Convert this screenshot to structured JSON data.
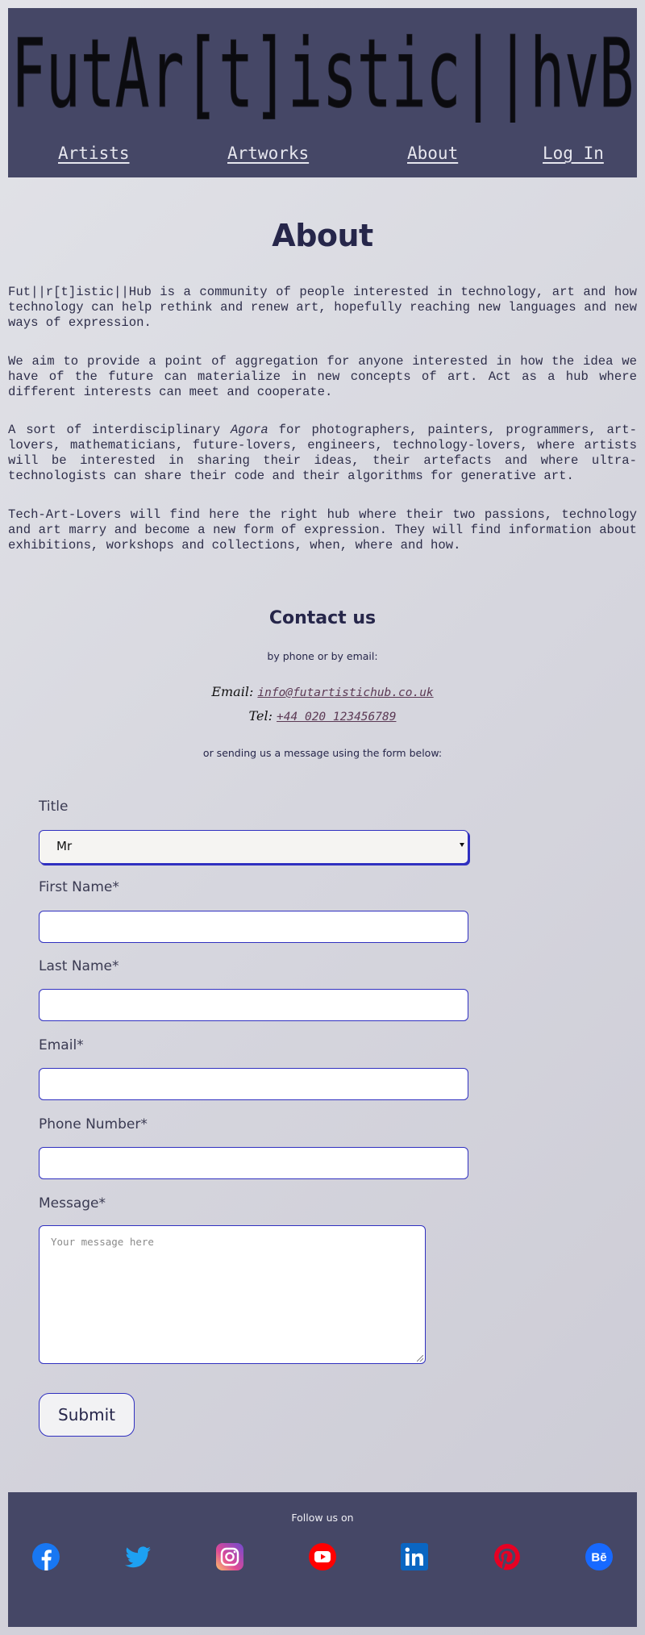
{
  "header": {
    "logo_text": "FutAr[t]istic||hvB",
    "nav": [
      {
        "label": "Artists"
      },
      {
        "label": "Artworks"
      },
      {
        "label": "About"
      },
      {
        "label": "Log In"
      }
    ]
  },
  "about": {
    "title": "About",
    "p1": "Fut||r[t]istic||Hub is a community of people interested in technology, art and how technology can help rethink and renew art, hopefully reaching new languages and new ways of expression.",
    "p2": "We aim to provide a point of aggregation for anyone interested in how the idea we have of the future can materialize in new concepts of art. Act as a hub where different interests can meet and cooperate.",
    "p3_before": "A sort of interdisciplinary ",
    "p3_em": "Agora",
    "p3_after": " for photographers, painters, programmers, art-lovers, mathematicians, future-lovers, engineers, technology-lovers, where artists will be interested in sharing their ideas, their artefacts and where ultra-technologists can share their code and their algorithms for generative art.",
    "p4": "Tech-Art-Lovers will find here the right hub where their two passions, technology and art marry and become a new form of expression. They will find information about exhibitions, workshops and collections, when, where and how."
  },
  "contact": {
    "title": "Contact us",
    "subtitle": "by phone or by email:",
    "email_label": "Email:",
    "email_value": "info@futartistichub.co.uk",
    "tel_label": "Tel:",
    "tel_value": "+44 020 123456789",
    "form_intro": "or sending us a message using the form below:"
  },
  "form": {
    "title_label": "Title",
    "title_value": "Mr",
    "first_name_label": "First Name*",
    "last_name_label": "Last Name*",
    "email_label": "Email*",
    "phone_label": "Phone Number*",
    "message_label": "Message*",
    "message_placeholder": "Your message here",
    "submit_label": "Submit"
  },
  "footer": {
    "follow_text": "Follow us on",
    "socials": [
      "facebook-icon",
      "twitter-icon",
      "instagram-icon",
      "youtube-icon",
      "linkedin-icon",
      "pinterest-icon",
      "behance-icon"
    ]
  },
  "colors": {
    "header_bg": "#454766",
    "input_border": "#3030c0",
    "text_dark": "#26264a"
  }
}
